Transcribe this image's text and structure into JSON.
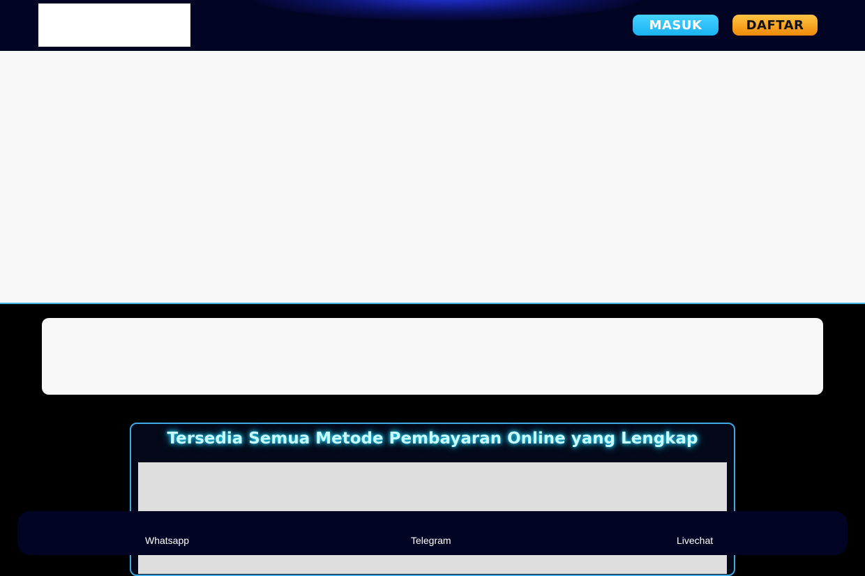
{
  "header": {
    "login_label": "MASUK",
    "register_label": "DAFTAR"
  },
  "payment": {
    "title": "Tersedia Semua Metode Pembayaran Online yang Lengkap"
  },
  "contact_bar": {
    "items": [
      {
        "label": "Whatsapp"
      },
      {
        "label": "Telegram"
      },
      {
        "label": "Livechat"
      }
    ]
  },
  "colors": {
    "header_bg": "#020424",
    "login_button": "#1ab2f2",
    "register_button": "#f08a0a",
    "accent_border": "#3fa9e6",
    "title_glow": "#2ae0ff"
  }
}
